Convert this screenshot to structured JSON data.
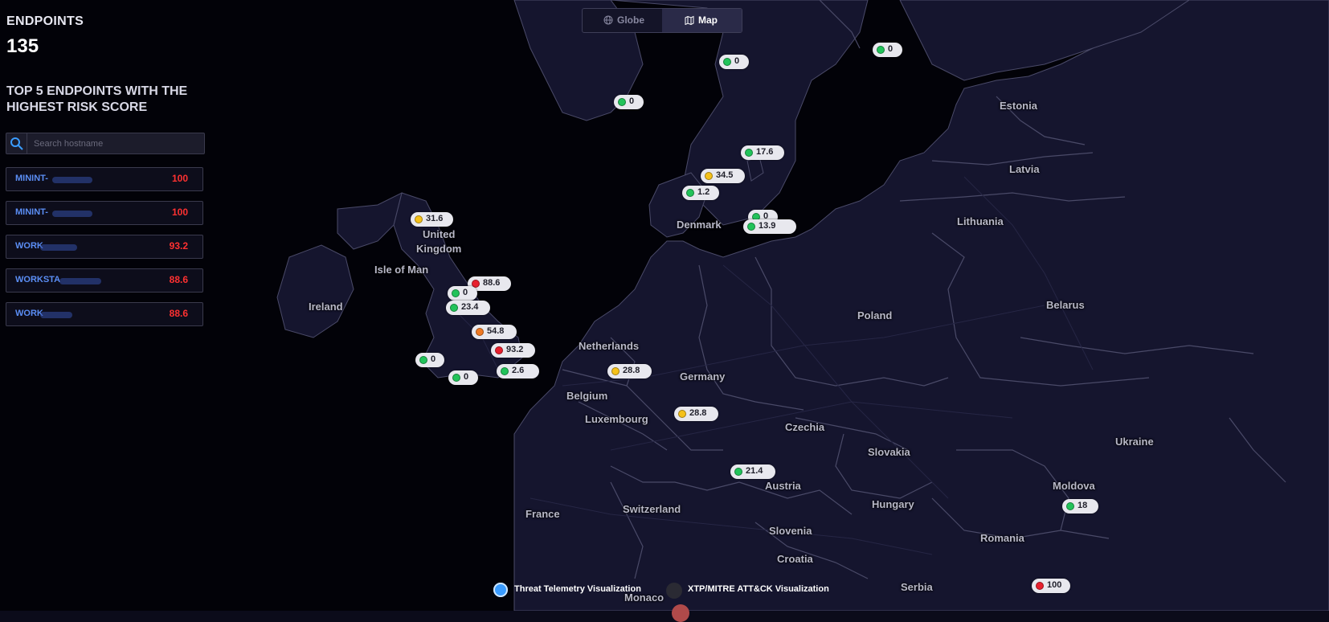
{
  "colors": {
    "background": "#0b0b1a",
    "water": "#020208",
    "land": "#15152e",
    "border": "#4a4a68",
    "accent": "#5b8ef5",
    "score_high": "#ff3131",
    "dot_green": "#22c35a",
    "dot_yellow": "#f5c11a",
    "dot_orange": "#f07a24",
    "dot_red": "#e8202e"
  },
  "panel": {
    "endpoints_label": "ENDPOINTS",
    "endpoints_count": "135",
    "top5_title": "TOP 5 ENDPOINTS WITH THE HIGHEST RISK SCORE",
    "search_placeholder": "Search hostname",
    "endpoints": [
      {
        "name": "MININT-",
        "score": "100"
      },
      {
        "name": "MININT-",
        "score": "100"
      },
      {
        "name": "WORK",
        "score": "93.2"
      },
      {
        "name": "WORKSTA",
        "score": "88.6"
      },
      {
        "name": "WORK",
        "score": "88.6"
      }
    ]
  },
  "view_toggle": {
    "globe_label": "Globe",
    "map_label": "Map",
    "active": "Map"
  },
  "legend": {
    "threat_label": "Threat Telemetry Visualization",
    "xtp_label": "XTP/MITRE ATT&CK Visualization"
  },
  "map": {
    "countries": [
      "Estonia",
      "Latvia",
      "Lithuania",
      "Denmark",
      "United Kingdom",
      "Isle of Man",
      "Ireland",
      "Belarus",
      "Poland",
      "Netherlands",
      "Germany",
      "Belgium",
      "Luxembourg",
      "Czechia",
      "Slovakia",
      "Ukraine",
      "Moldova",
      "Austria",
      "Hungary",
      "Romania",
      "France",
      "Switzerland",
      "Slovenia",
      "Croatia",
      "Serbia",
      "Monaco"
    ],
    "markers": [
      {
        "value": "0",
        "level": "green"
      },
      {
        "value": "0",
        "level": "green"
      },
      {
        "value": "0",
        "level": "green"
      },
      {
        "value": "17.6",
        "level": "green"
      },
      {
        "value": "34.5",
        "level": "yellow"
      },
      {
        "value": "1.2",
        "level": "green"
      },
      {
        "value": "0",
        "level": "green"
      },
      {
        "value": "13.9",
        "level": "green"
      },
      {
        "value": "31.6",
        "level": "yellow"
      },
      {
        "value": "88.6",
        "level": "red"
      },
      {
        "value": "0",
        "level": "green"
      },
      {
        "value": "23.4",
        "level": "green"
      },
      {
        "value": "54.8",
        "level": "orange"
      },
      {
        "value": "93.2",
        "level": "red"
      },
      {
        "value": "0",
        "level": "green"
      },
      {
        "value": "0",
        "level": "green"
      },
      {
        "value": "2.6",
        "level": "green"
      },
      {
        "value": "28.8",
        "level": "yellow"
      },
      {
        "value": "28.8",
        "level": "yellow"
      },
      {
        "value": "21.4",
        "level": "green"
      },
      {
        "value": "18",
        "level": "green"
      },
      {
        "value": "100",
        "level": "red"
      }
    ]
  }
}
